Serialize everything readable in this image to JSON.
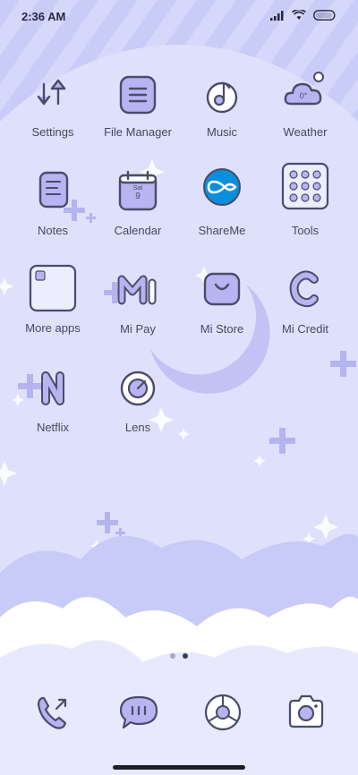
{
  "status_bar": {
    "time": "2:36 AM"
  },
  "apps": [
    {
      "name": "app-settings",
      "icon": "settings-icon",
      "label": "Settings"
    },
    {
      "name": "app-file-manager",
      "icon": "file-manager-icon",
      "label": "File Manager"
    },
    {
      "name": "app-music",
      "icon": "music-icon",
      "label": "Music"
    },
    {
      "name": "app-weather",
      "icon": "weather-icon",
      "label": "Weather",
      "icon_text": "0°"
    },
    {
      "name": "app-notes",
      "icon": "notes-icon",
      "label": "Notes"
    },
    {
      "name": "app-calendar",
      "icon": "calendar-icon",
      "label": "Calendar",
      "icon_day": "Sat",
      "icon_date": "9"
    },
    {
      "name": "app-shareme",
      "icon": "shareme-icon",
      "label": "ShareMe"
    },
    {
      "name": "app-tools",
      "icon": "tools-icon",
      "label": "Tools"
    },
    {
      "name": "app-more-apps",
      "icon": "folder-icon",
      "label": "More apps"
    },
    {
      "name": "app-mi-pay",
      "icon": "mi-pay-icon",
      "label": "Mi Pay"
    },
    {
      "name": "app-mi-store",
      "icon": "mi-store-icon",
      "label": "Mi Store"
    },
    {
      "name": "app-mi-credit",
      "icon": "mi-credit-icon",
      "label": "Mi Credit"
    },
    {
      "name": "app-netflix",
      "icon": "netflix-icon",
      "label": "Netflix"
    },
    {
      "name": "app-lens",
      "icon": "lens-icon",
      "label": "Lens"
    }
  ],
  "dock": [
    {
      "name": "dock-phone",
      "icon": "phone-icon"
    },
    {
      "name": "dock-messages",
      "icon": "message-icon"
    },
    {
      "name": "dock-browser",
      "icon": "browser-icon"
    },
    {
      "name": "dock-camera",
      "icon": "camera-icon"
    }
  ],
  "page_indicator": {
    "pages": 2,
    "active": 2
  },
  "colors": {
    "icon_fill": "#b7b4f2",
    "icon_stroke": "#4a4c6a",
    "sky": "#d9dcfb",
    "moon": "#c3c4f5",
    "cloud": "#ffffff"
  }
}
